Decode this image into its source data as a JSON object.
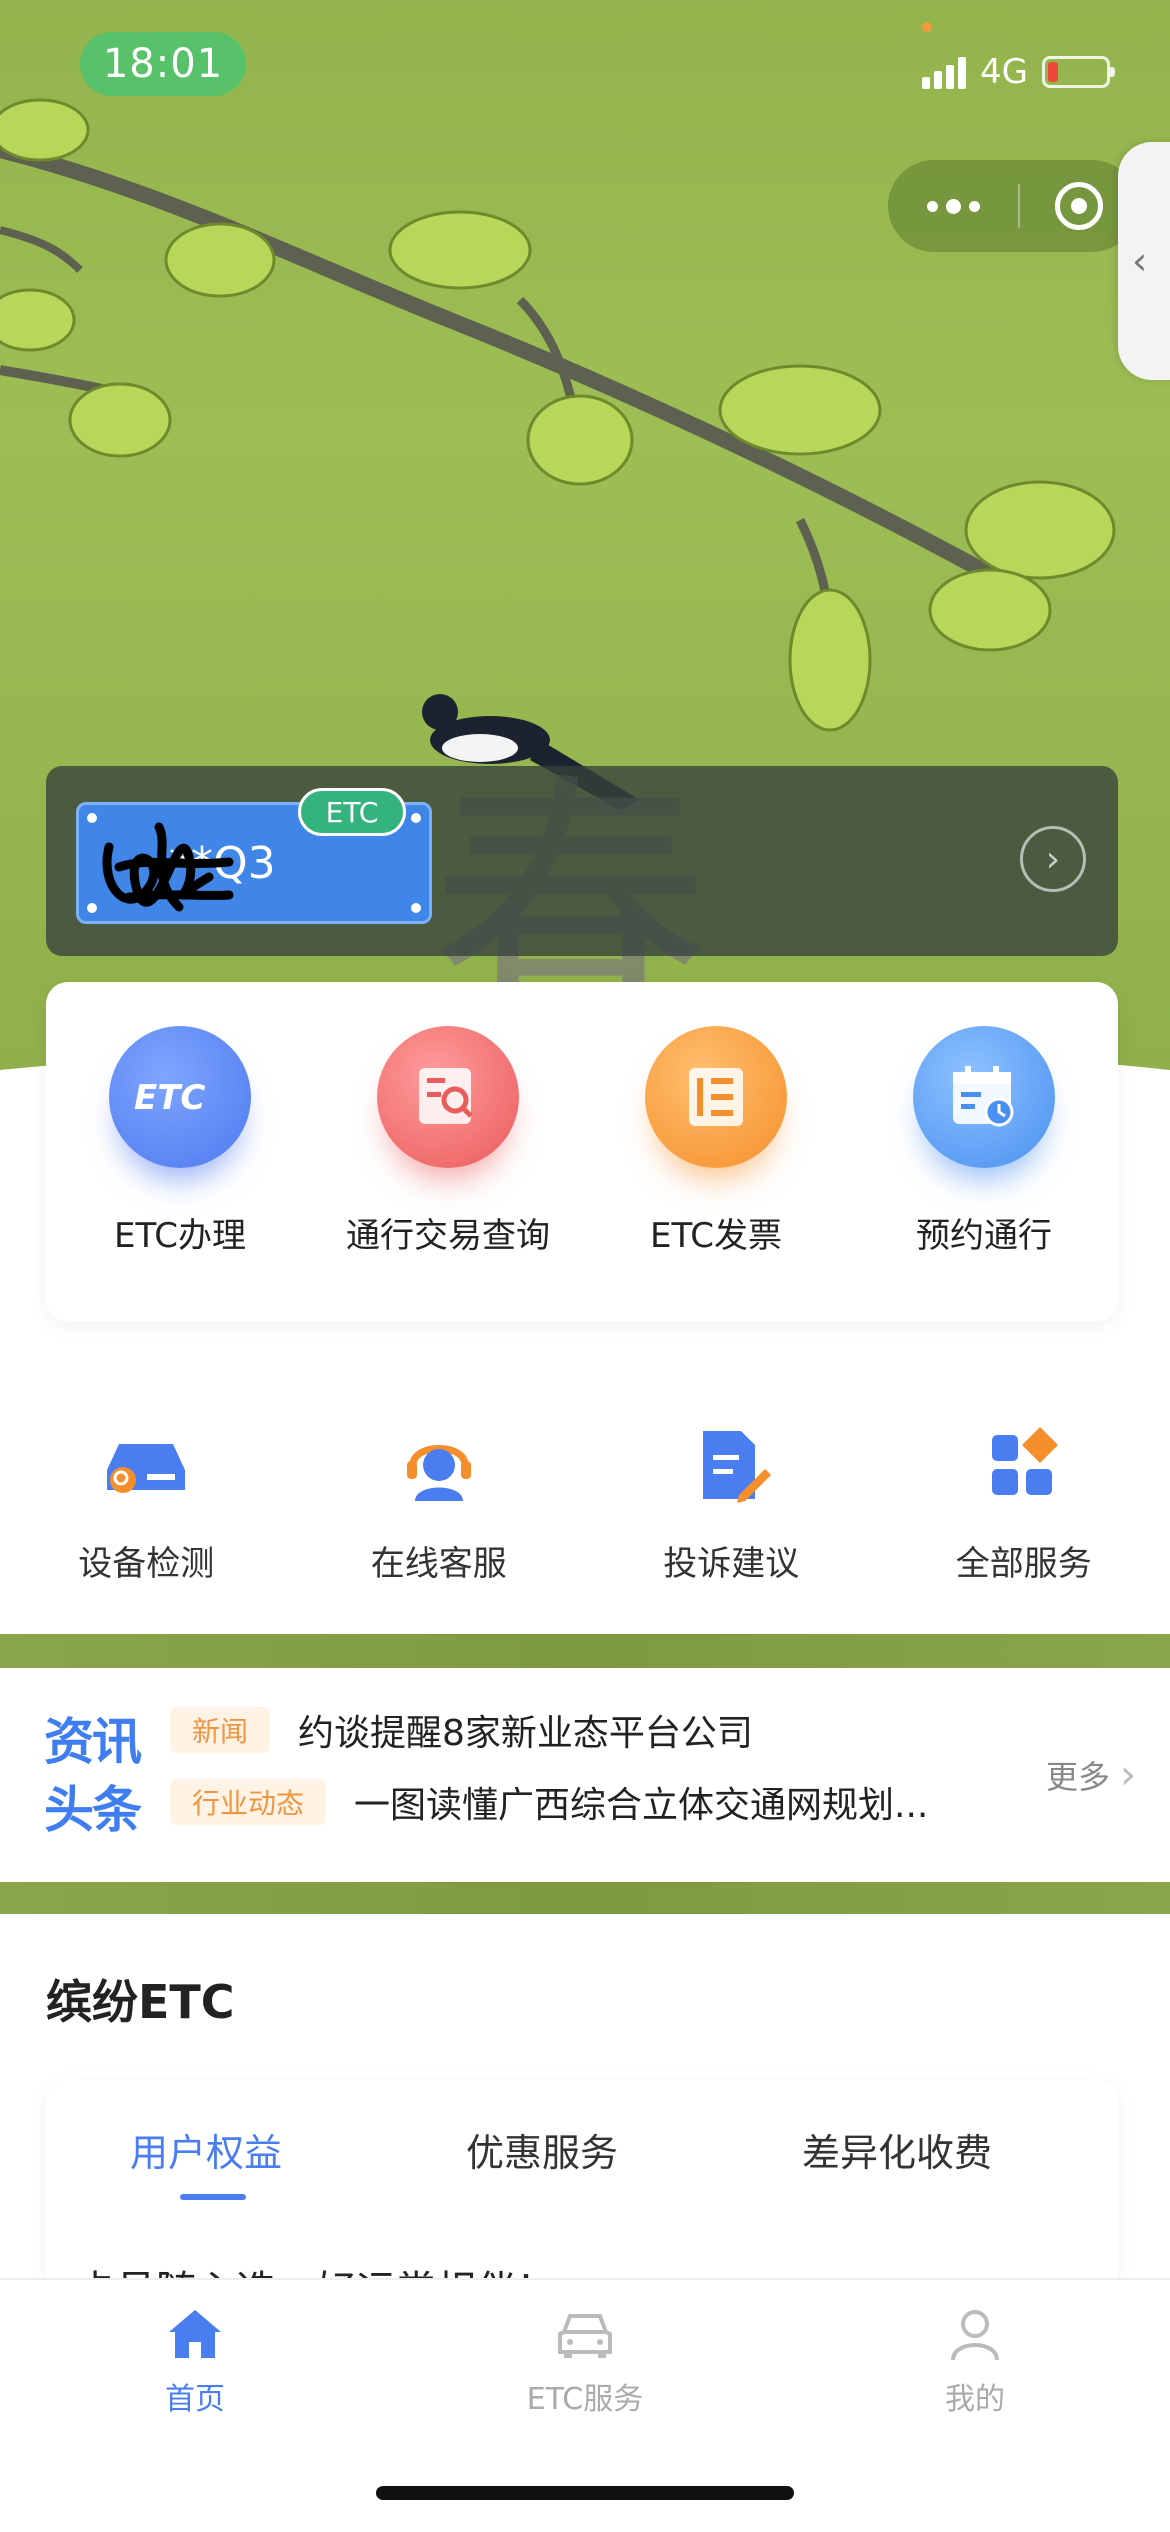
{
  "status_bar": {
    "time": "18:01",
    "network": "4G"
  },
  "vehicle": {
    "plate": "**Q3",
    "badge": "ETC"
  },
  "main_services": [
    {
      "label": "ETC办理",
      "icon": "etc-logo-icon",
      "color": "#4e79ee"
    },
    {
      "label": "通行交易查询",
      "icon": "document-search-icon",
      "color": "#ea5b5b"
    },
    {
      "label": "ETC发票",
      "icon": "invoice-icon",
      "color": "#f58f2c"
    },
    {
      "label": "预约通行",
      "icon": "calendar-clock-icon",
      "color": "#4a90f0"
    }
  ],
  "secondary_services": [
    {
      "label": "设备检测",
      "icon": "device-check-icon"
    },
    {
      "label": "在线客服",
      "icon": "customer-service-icon"
    },
    {
      "label": "投诉建议",
      "icon": "complaint-edit-icon"
    },
    {
      "label": "全部服务",
      "icon": "all-services-grid-icon"
    }
  ],
  "news": {
    "logo_line1": "资讯",
    "logo_line2": "头条",
    "items": [
      {
        "tag": "新闻",
        "text": "约谈提醒8家新业态平台公司"
      },
      {
        "tag": "行业动态",
        "text": "一图读懂广西综合立体交通网规划..."
      }
    ],
    "more": "更多"
  },
  "etc_section": {
    "title": "缤纷ETC",
    "tabs": [
      "用户权益",
      "优惠服务",
      "差异化收费"
    ],
    "active_tab": 0,
    "description": "卡号随心选，好运常相伴！"
  },
  "bottom_nav": [
    {
      "label": "首页",
      "icon": "home-icon",
      "active": true
    },
    {
      "label": "ETC服务",
      "icon": "car-icon",
      "active": false
    },
    {
      "label": "我的",
      "icon": "user-icon",
      "active": false
    }
  ],
  "colors": {
    "accent": "#4a7ef0",
    "news_tag": "#f09540",
    "etc_badge": "#35b37e"
  }
}
